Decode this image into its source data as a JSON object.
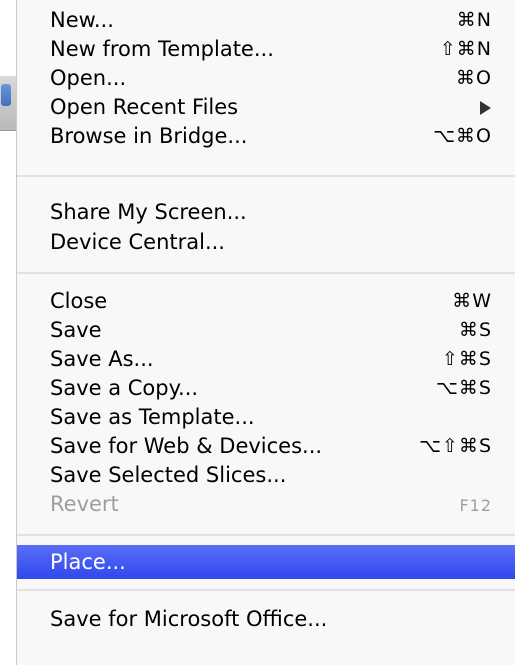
{
  "menu": {
    "groups": [
      [
        {
          "label": "New...",
          "shortcut": "⌘N"
        },
        {
          "label": "New from Template...",
          "shortcut": "⇧⌘N"
        },
        {
          "label": "Open...",
          "shortcut": "⌘O"
        },
        {
          "label": "Open Recent Files",
          "shortcut": ""
        },
        {
          "label": "Browse in Bridge...",
          "shortcut": "⌥⌘O"
        }
      ],
      [
        {
          "label": "Share My Screen...",
          "shortcut": ""
        },
        {
          "label": "Device Central...",
          "shortcut": ""
        }
      ],
      [
        {
          "label": "Close",
          "shortcut": "⌘W"
        },
        {
          "label": "Save",
          "shortcut": "⌘S"
        },
        {
          "label": "Save As...",
          "shortcut": "⇧⌘S"
        },
        {
          "label": "Save a Copy...",
          "shortcut": "⌥⌘S"
        },
        {
          "label": "Save as Template...",
          "shortcut": ""
        },
        {
          "label": "Save for Web & Devices...",
          "shortcut": "⌥⇧⌘S"
        },
        {
          "label": "Save Selected Slices...",
          "shortcut": ""
        },
        {
          "label": "Revert",
          "shortcut": "F12",
          "disabled": true
        }
      ],
      [
        {
          "label": "Place...",
          "shortcut": "",
          "highlighted": true
        }
      ],
      [
        {
          "label": "Save for Microsoft Office...",
          "shortcut": ""
        }
      ]
    ]
  },
  "colors": {
    "highlight": "#3a52f0",
    "disabled_text": "#9e9e9e",
    "separator": "#e2e2e2"
  },
  "icons": {
    "submenu": "chevron-right-icon"
  }
}
